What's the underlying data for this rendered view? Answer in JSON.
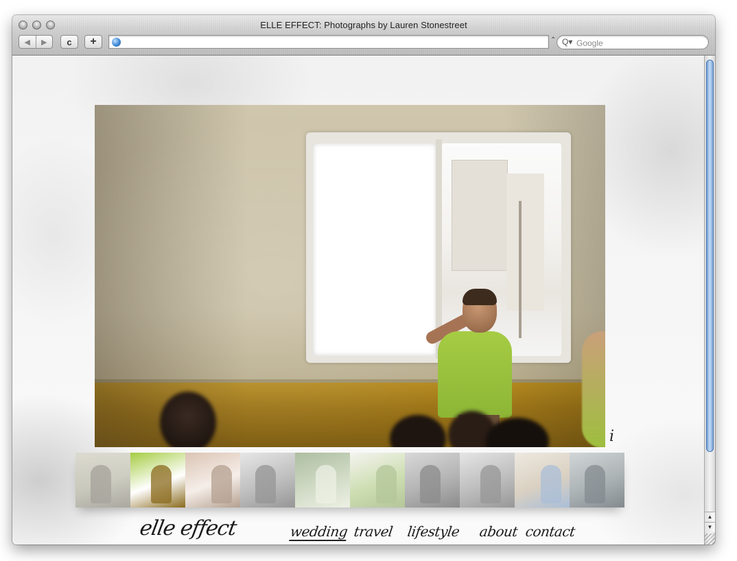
{
  "window": {
    "title": "ELLE EFFECT: Photographs by Lauren Stonestreet"
  },
  "toolbar": {
    "back_icon": "back-arrow-icon",
    "forward_icon": "forward-arrow-icon",
    "reload_label": "c",
    "add_bookmark_label": "+",
    "url_value": "",
    "search_placeholder": "Google",
    "search_icon_label": "Q▾"
  },
  "page": {
    "info_glyph": "i",
    "logo": "elle effect",
    "nav": [
      {
        "label": "wedding",
        "selected": true
      },
      {
        "label": "travel",
        "selected": false
      },
      {
        "label": "lifestyle",
        "selected": false
      },
      {
        "label": "about",
        "selected": false
      },
      {
        "label": "contact",
        "selected": false
      }
    ],
    "thumbnails": [
      {
        "subject": "house-and-figure",
        "palette": [
          "#b9b9a6",
          "#d9d7c6",
          "#7d7a6c"
        ],
        "active": false
      },
      {
        "subject": "boy-at-window",
        "palette": [
          "#ffffff",
          "#a6cc44",
          "#8a6a1c"
        ],
        "active": true
      },
      {
        "subject": "smiling-woman",
        "palette": [
          "#f4e8df",
          "#caa58c",
          "#8b6a50"
        ],
        "active": false
      },
      {
        "subject": "boy-black-and-white",
        "palette": [
          "#9c9c9c",
          "#dcdcdc",
          "#5a5a5a"
        ],
        "active": false
      },
      {
        "subject": "girl-in-garden",
        "palette": [
          "#b9c9a7",
          "#7f9b6c",
          "#e6ecd8"
        ],
        "active": false
      },
      {
        "subject": "bride-on-grass",
        "palette": [
          "#b4cf88",
          "#f2f2ec",
          "#8aa860"
        ],
        "active": false
      },
      {
        "subject": "crowd-black-and-white",
        "palette": [
          "#8a8a8a",
          "#c6c6c6",
          "#4a4a4a"
        ],
        "active": false
      },
      {
        "subject": "tree-black-and-white",
        "palette": [
          "#9a9a9a",
          "#dadada",
          "#5c5c5c"
        ],
        "active": false
      },
      {
        "subject": "children-outdoors",
        "palette": [
          "#c8b9a0",
          "#e6dfd2",
          "#7b9bc4"
        ],
        "active": false
      },
      {
        "subject": "man-portrait",
        "palette": [
          "#7f8a8e",
          "#b9c0c2",
          "#3f4a52"
        ],
        "active": false
      }
    ]
  },
  "colors": {
    "accent_scroll": "#6b9bd6",
    "ink": "#1a1a1a"
  }
}
